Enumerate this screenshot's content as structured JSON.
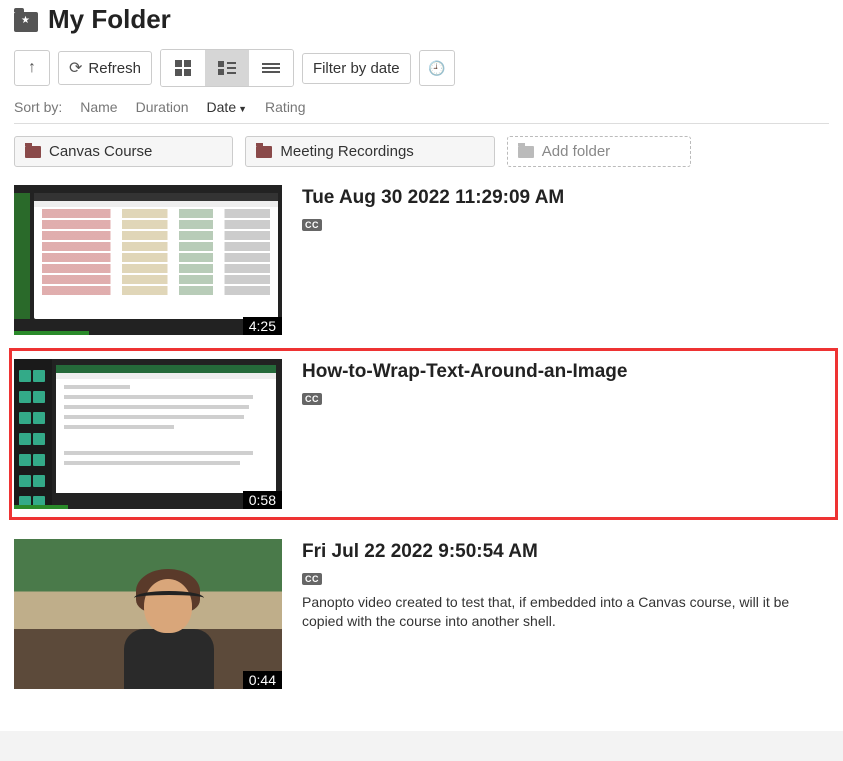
{
  "header": {
    "title": "My Folder"
  },
  "toolbar": {
    "refresh_label": "Refresh",
    "filter_label": "Filter by date"
  },
  "sort": {
    "label": "Sort by:",
    "name": "Name",
    "duration": "Duration",
    "date": "Date",
    "rating": "Rating"
  },
  "folders": {
    "items": [
      {
        "label": "Canvas Course"
      },
      {
        "label": "Meeting Recordings"
      }
    ],
    "add_label": "Add folder"
  },
  "videos": [
    {
      "title": "Tue Aug 30 2022 11:29:09 AM",
      "duration": "4:25",
      "cc": "CC",
      "description": "",
      "highlighted": false,
      "progress_pct": 28
    },
    {
      "title": "How-to-Wrap-Text-Around-an-Image",
      "duration": "0:58",
      "cc": "CC",
      "description": "",
      "highlighted": true,
      "progress_pct": 20
    },
    {
      "title": "Fri Jul 22 2022 9:50:54 AM",
      "duration": "0:44",
      "cc": "CC",
      "description": "Panopto video created to test that, if embedded into a Canvas course, will it be copied with the course into another shell.",
      "highlighted": false,
      "progress_pct": 0
    }
  ]
}
